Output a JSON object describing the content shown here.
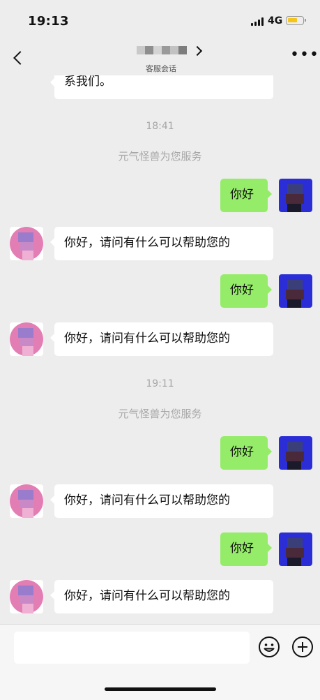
{
  "status_bar": {
    "time": "19:13",
    "network": "4G"
  },
  "header": {
    "subtitle": "客服会话"
  },
  "messages": {
    "truncated_text": "系我们。",
    "time1": "18:41",
    "system1": "元气怪兽为您服务",
    "user_msg1": "你好",
    "agent_msg1": "你好，请问有什么可以帮助您的",
    "user_msg2": "你好",
    "agent_msg2": "你好，请问有什么可以帮助您的",
    "time2": "19:11",
    "system2": "元气怪兽为您服务",
    "user_msg3": "你好",
    "agent_msg3": "你好，请问有什么可以帮助您的",
    "user_msg4": "你好",
    "agent_msg4": "你好，请问有什么可以帮助您的"
  },
  "input": {
    "value": ""
  },
  "icons": {
    "back": "chevron-left-icon",
    "more": "more-icon",
    "emoji": "emoji-icon",
    "plus": "plus-icon"
  },
  "colors": {
    "background": "#ededed",
    "user_bubble": "#95ec69",
    "agent_bubble": "#ffffff",
    "agent_avatar": "#e37eb4",
    "user_avatar": "#2b2ed6"
  }
}
